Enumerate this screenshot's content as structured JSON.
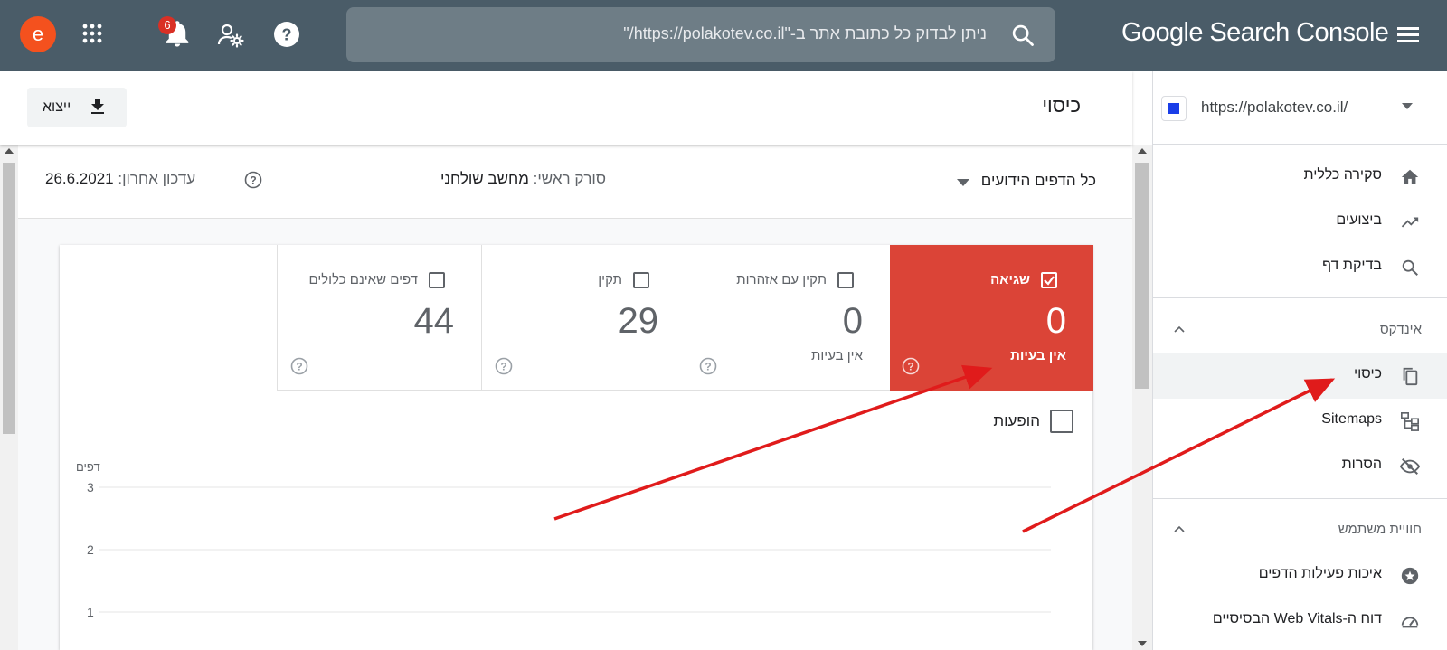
{
  "topbar": {
    "brand": "Google Search Console",
    "search_placeholder": "ניתן לבדוק כל כתובת אתר ב-\"https://polakotev.co.il/\"",
    "avatar_letter": "e",
    "notification_count": "6"
  },
  "property": {
    "url": "https://polakotev.co.il/"
  },
  "sidebar": {
    "items": [
      {
        "label": "סקירה כללית",
        "icon": "home-icon"
      },
      {
        "label": "ביצועים",
        "icon": "trending-up-icon"
      },
      {
        "label": "בדיקת דף",
        "icon": "search-icon"
      }
    ],
    "sections": [
      {
        "title": "אינדקס",
        "items": [
          {
            "label": "כיסוי",
            "icon": "pages-icon",
            "active": true
          },
          {
            "label": "Sitemaps",
            "icon": "sitemap-icon"
          },
          {
            "label": "הסרות",
            "icon": "eye-off-icon"
          }
        ]
      },
      {
        "title": "חוויית משתמש",
        "items": [
          {
            "label": "איכות פעילות הדפים",
            "icon": "badge-icon"
          },
          {
            "label": "דוח ה-Web Vitals הבסיסיים",
            "icon": "gauge-icon"
          }
        ]
      }
    ]
  },
  "header": {
    "title": "כיסוי",
    "export_label": "ייצוא"
  },
  "filter": {
    "pages_label": "כל הדפים הידועים",
    "crawler_prefix": "סורק ראשי:",
    "crawler_value": "מחשב שולחני",
    "updated_prefix": "עדכון אחרון:",
    "updated_value": "26.6.2021"
  },
  "stats": [
    {
      "label": "שגיאה",
      "value": "0",
      "sub": "אין בעיות",
      "checked": true,
      "color": "#db4437"
    },
    {
      "label": "תקין עם אזהרות",
      "value": "0",
      "sub": "אין בעיות",
      "checked": false
    },
    {
      "label": "תקין",
      "value": "29",
      "sub": "",
      "checked": false
    },
    {
      "label": "דפים שאינם כלולים",
      "value": "44",
      "sub": "",
      "checked": false
    }
  ],
  "impressions_label": "הופעות",
  "chart_data": {
    "type": "line",
    "ylabel": "דפים",
    "ylim": [
      0,
      3
    ],
    "yticks": [
      "3",
      "2",
      "1"
    ],
    "series": []
  },
  "colors": {
    "topbar": "#4a5c68",
    "error": "#db4437",
    "arrow": "#e01b1b"
  }
}
